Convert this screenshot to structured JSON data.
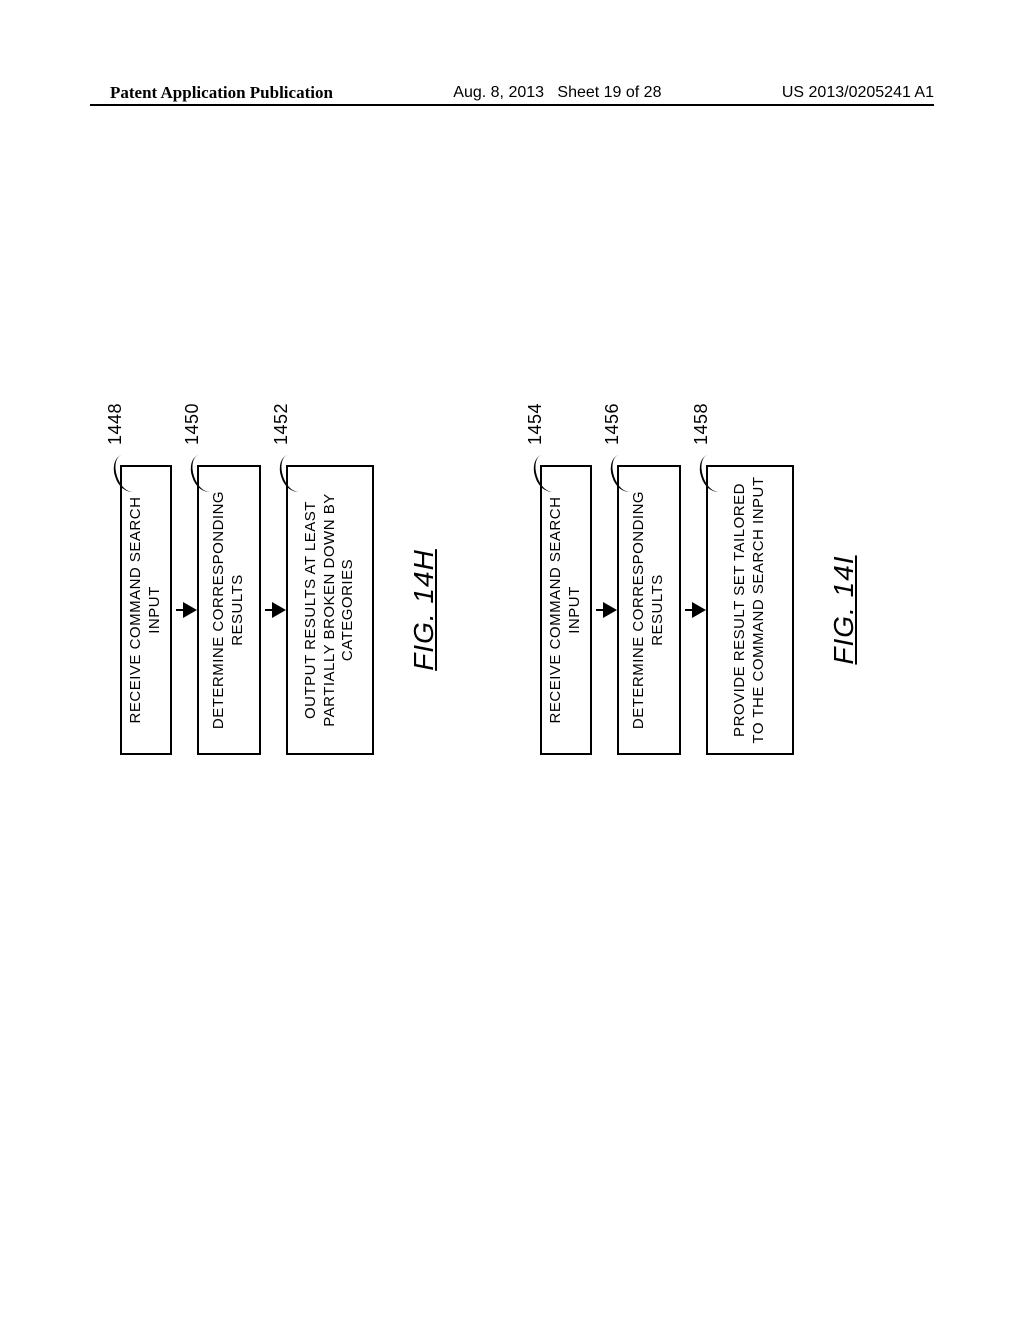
{
  "header": {
    "left": "Patent Application Publication",
    "center_date": "Aug. 8, 2013",
    "center_sheet": "Sheet 19 of 28",
    "right": "US 2013/0205241 A1"
  },
  "flowchart_h": {
    "label": "FIG. 14H",
    "steps": [
      {
        "ref": "1448",
        "text": "RECEIVE COMMAND SEARCH INPUT"
      },
      {
        "ref": "1450",
        "text": "DETERMINE CORRESPONDING RESULTS"
      },
      {
        "ref": "1452",
        "text": "OUTPUT RESULTS AT LEAST PARTIALLY BROKEN DOWN BY CATEGORIES"
      }
    ]
  },
  "flowchart_i": {
    "label": "FIG. 14I",
    "steps": [
      {
        "ref": "1454",
        "text": "RECEIVE COMMAND SEARCH INPUT"
      },
      {
        "ref": "1456",
        "text": "DETERMINE CORRESPONDING RESULTS"
      },
      {
        "ref": "1458",
        "text": "PROVIDE RESULT SET TAILORED TO THE COMMAND SEARCH INPUT"
      }
    ]
  }
}
